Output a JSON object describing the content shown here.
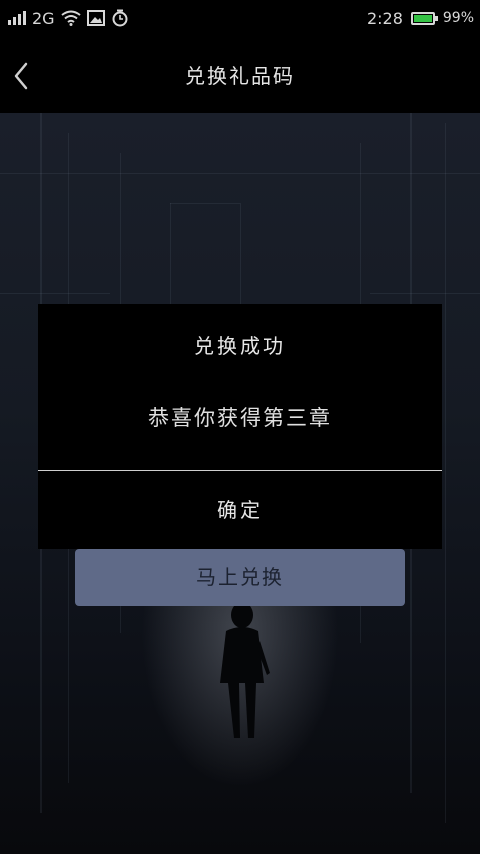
{
  "status_bar": {
    "network": "2G",
    "time": "2:28",
    "battery_percent": "99%",
    "battery_level": 0.99,
    "battery_color": "#35c245",
    "icons": [
      "signal-icon",
      "wifi-icon",
      "image-icon",
      "alarm-icon",
      "battery-icon"
    ]
  },
  "nav": {
    "back_icon": "chevron-left-icon",
    "title": "兑换礼品码"
  },
  "main": {
    "redeem_button": "马上兑换",
    "redeem_button_color": "#5f6a88"
  },
  "dialog": {
    "title": "兑换成功",
    "message": "恭喜你获得第三章",
    "confirm": "确定"
  }
}
